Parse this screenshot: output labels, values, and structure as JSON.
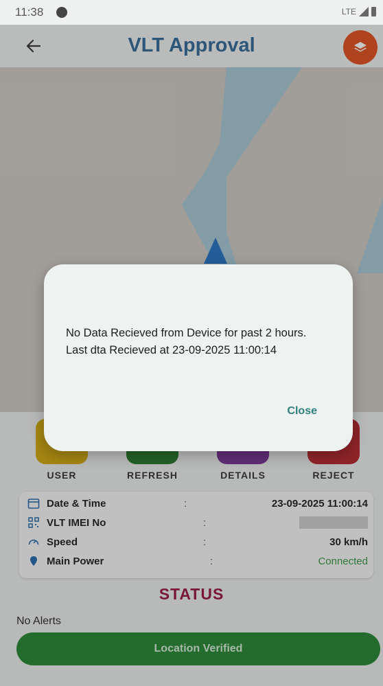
{
  "status_bar": {
    "time": "11:38",
    "network": "LTE"
  },
  "app_bar": {
    "title": "VLT Approval"
  },
  "actions": [
    {
      "label": "USER",
      "color": "#d3ab18"
    },
    {
      "label": "REFRESH",
      "color": "#2f7d33"
    },
    {
      "label": "DETAILS",
      "color": "#7a3a96"
    },
    {
      "label": "REJECT",
      "color": "#b62f35"
    }
  ],
  "info": {
    "rows": [
      {
        "label": "Date & Time",
        "sep": ":",
        "value": "23-09-2025 11:00:14"
      },
      {
        "label": "VLT IMEI No",
        "sep": ":",
        "value": ""
      },
      {
        "label": "Speed",
        "sep": ":",
        "value": "30 km/h"
      },
      {
        "label": "Main Power",
        "sep": ":",
        "value": "Connected"
      }
    ]
  },
  "status_heading": "STATUS",
  "alerts_text": "No Alerts",
  "verify_button": {
    "label": "Location Verified"
  },
  "dialog": {
    "message": "No Data Recieved from Device for past 2 hours. Last dta Recieved at 23-09-2025 11:00:14",
    "close_label": "Close"
  },
  "colors": {
    "title": "#3b6f9c",
    "layers_button": "#e1572a",
    "status_heading": "#9c1e4a",
    "verify_button": "#2e8b3c",
    "power_connected": "#3e9a4a",
    "dialog_close": "#2f7f7d"
  },
  "icons": [
    "back-arrow-icon",
    "layers-icon",
    "calendar-icon",
    "qr-code-icon",
    "speedometer-icon",
    "power-pin-icon",
    "map-marker-icon"
  ]
}
